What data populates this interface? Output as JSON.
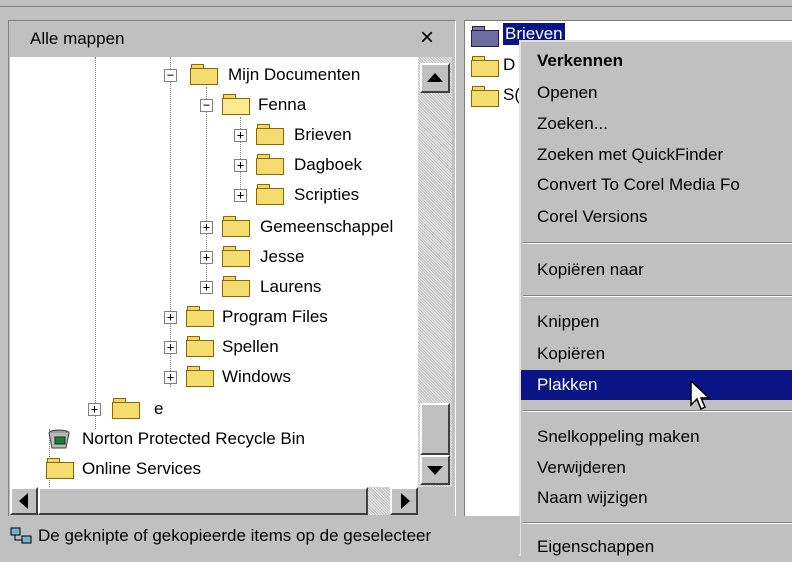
{
  "left_pane": {
    "title": "Alle mappen",
    "close": "×",
    "tree": [
      {
        "label": "Mijn Documenten",
        "expander": "−"
      },
      {
        "label": "Fenna",
        "expander": "−"
      },
      {
        "label": "Brieven",
        "expander": "+"
      },
      {
        "label": "Dagboek",
        "expander": "+"
      },
      {
        "label": "Scripties",
        "expander": "+"
      },
      {
        "label": "Gemeenschappel",
        "expander": "+"
      },
      {
        "label": "Jesse",
        "expander": "+"
      },
      {
        "label": "Laurens",
        "expander": "+"
      },
      {
        "label": "Program Files",
        "expander": "+"
      },
      {
        "label": "Spellen",
        "expander": "+"
      },
      {
        "label": "Windows",
        "expander": "+"
      },
      {
        "label": "e",
        "expander": "+"
      },
      {
        "label": "Norton Protected Recycle Bin",
        "expander": ""
      },
      {
        "label": "Online Services",
        "expander": ""
      }
    ]
  },
  "right_pane": {
    "items": [
      {
        "label": "Brieven"
      },
      {
        "label": "D"
      },
      {
        "label": "S("
      }
    ]
  },
  "context_menu": {
    "items": [
      {
        "label": "Verkennen"
      },
      {
        "label": "Openen"
      },
      {
        "label": "Zoeken..."
      },
      {
        "label": "Zoeken met QuickFinder"
      },
      {
        "label": "Convert To Corel Media Fo"
      },
      {
        "label": "Corel Versions"
      },
      {
        "label": "Kopiëren naar"
      },
      {
        "label": "Knippen"
      },
      {
        "label": "Kopiëren"
      },
      {
        "label": "Plakken"
      },
      {
        "label": "Snelkoppeling maken"
      },
      {
        "label": "Verwijderen"
      },
      {
        "label": "Naam wijzigen"
      },
      {
        "label": "Eigenschappen"
      }
    ]
  },
  "status_bar": {
    "text": "De geknipte of gekopieerde items op de geselecteer"
  },
  "colors": {
    "highlight": "#0a1485",
    "face": "#c0c0c0",
    "folder": "#f4dc6e"
  }
}
